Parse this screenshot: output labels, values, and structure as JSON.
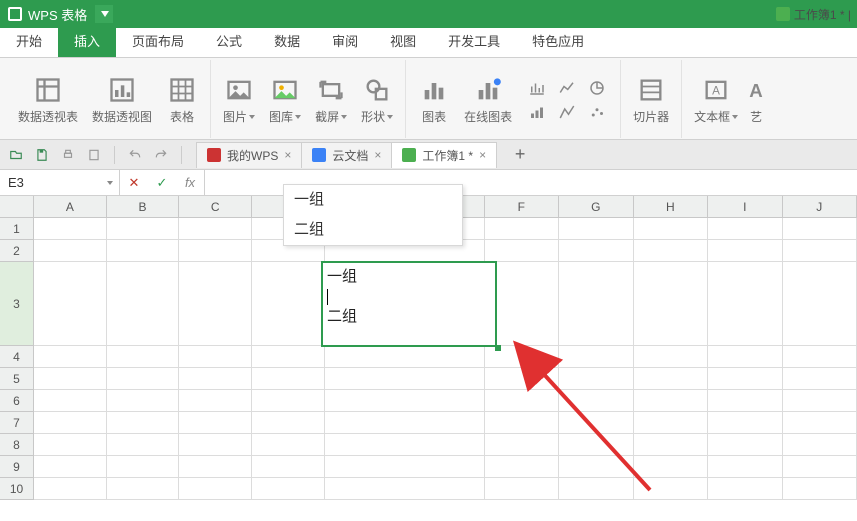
{
  "app": {
    "title": "WPS 表格",
    "doc_indicator": "工作簿1 * |"
  },
  "menus": [
    "开始",
    "插入",
    "页面布局",
    "公式",
    "数据",
    "审阅",
    "视图",
    "开发工具",
    "特色应用"
  ],
  "menus_active_index": 1,
  "ribbon": {
    "pivot_table": "数据透视表",
    "pivot_chart": "数据透视图",
    "table": "表格",
    "picture": "图片",
    "gallery": "图库",
    "screenshot": "截屏",
    "shapes": "形状",
    "chart": "图表",
    "online_chart": "在线图表",
    "slicer": "切片器",
    "textbox": "文本框",
    "art": "艺"
  },
  "doctabs": [
    {
      "label": "我的WPS",
      "icon": "wps"
    },
    {
      "label": "云文档",
      "icon": "cloud"
    },
    {
      "label": "工作簿1 *",
      "icon": "sheet",
      "active": true
    }
  ],
  "formula_bar": {
    "cell_ref": "E3",
    "formula": ""
  },
  "suggestions": [
    "一组",
    "二组"
  ],
  "grid": {
    "columns": [
      "A",
      "B",
      "C",
      "D",
      "E",
      "F",
      "G",
      "H",
      "I",
      "J"
    ],
    "row_count": 10,
    "tall_row_index": 3,
    "e3_lines": [
      "一组",
      "",
      "二组"
    ]
  }
}
